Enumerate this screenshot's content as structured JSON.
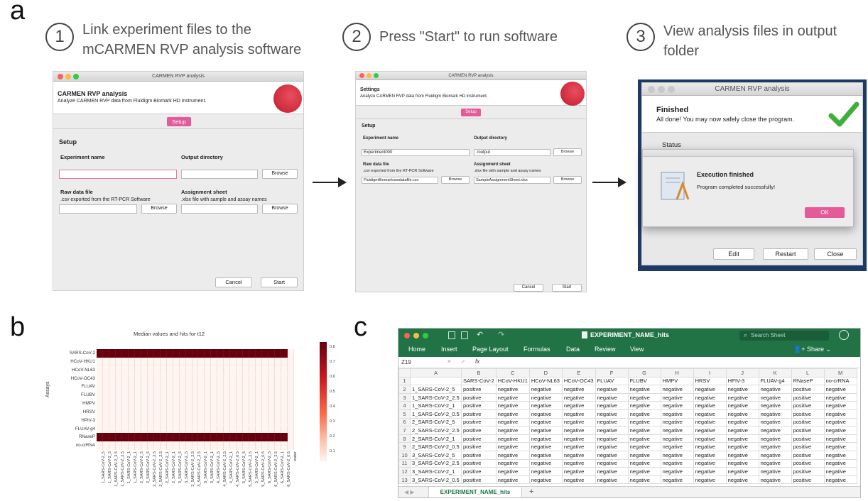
{
  "panels": {
    "a": "a",
    "b": "b",
    "c": "c"
  },
  "steps": [
    {
      "num": "1",
      "text": "Link experiment files to the mCARMEN RVP analysis software"
    },
    {
      "num": "2",
      "text": "Press \"Start\" to run software"
    },
    {
      "num": "3",
      "text": "View analysis files in output folder"
    }
  ],
  "win1": {
    "title": "CARMEN RVP analysis",
    "header_title": "CARMEN RVP analysis",
    "header_sub": "Analyze CARMEN RVP data from Fluidigm Biomark HD instrument.",
    "tab": "Setup",
    "section": "Setup",
    "exp_label": "Experiment name",
    "out_label": "Output directory",
    "browse": "Browse",
    "raw_label": "Raw data file",
    "raw_sub": ".csv exported from the RT-PCR Software",
    "assign_label": "Assignment sheet",
    "assign_sub": ".xlsx file with sample and assay names",
    "cancel": "Cancel",
    "start": "Start"
  },
  "win2": {
    "title": "CARMEN RVP analysis",
    "header_title": "Settings",
    "header_sub": "Analyze CARMEN RVP data from Fluidigm Biomark HD instrument.",
    "tab": "Setup",
    "section": "Setup",
    "exp_label": "Experiment name",
    "exp_value": "Experiment000",
    "out_label": "Output directory",
    "out_value": "./output",
    "browse": "Browse",
    "raw_label": "Raw data file",
    "raw_sub": ".csv exported from the RT-PCR Software",
    "raw_value": "FluidigmBiomarkrawdatafile.csv",
    "assign_label": "Assignment sheet",
    "assign_sub": ".xlsx file with sample and assay names",
    "assign_value": "SampleAssignmentSheet.xlsx",
    "cancel": "Cancel",
    "start": "Start"
  },
  "win3": {
    "title": "CARMEN RVP analysis",
    "finished": "Finished",
    "done_msg": "All done! You may now safely close the program.",
    "status": "Status",
    "dialog_title": "Execution finished",
    "dialog_msg": "Program completed successfully!",
    "ok": "OK",
    "edit": "Edit",
    "restart": "Restart",
    "close": "Close"
  },
  "chart_data": {
    "type": "heatmap",
    "title": "Median values and hits for t12",
    "ylabel": "Assays",
    "assays": [
      "SARS-CoV-2",
      "HCoV-HKU1",
      "HCoV-NL63",
      "HCoV-OC43",
      "FLUAV",
      "FLUBV",
      "HMPV",
      "HRSV",
      "HPIV-3",
      "FLUAV-g4",
      "RNaseP",
      "no-crRNA"
    ],
    "samples": [
      "1_SARS-CoV-2_5",
      "1_SARS-CoV-2_5",
      "1_SARS-CoV-2_2.5",
      "1_SARS-CoV-2_2.5",
      "1_SARS-CoV-2_1",
      "1_SARS-CoV-2_1",
      "2_SARS-CoV-2_5",
      "2_SARS-CoV-2_5",
      "2_SARS-CoV-2_2.5",
      "2_SARS-CoV-2_2.5",
      "2_SARS-CoV-2_1",
      "2_SARS-CoV-2_1",
      "3_SARS-CoV-2_5",
      "3_SARS-CoV-2_5",
      "3_SARS-CoV-2_2.5",
      "3_SARS-CoV-2_2.5",
      "3_SARS-CoV-2_1",
      "3_SARS-CoV-2_1",
      "4_SARS-CoV-2_5",
      "4_SARS-CoV-2_2.5",
      "4_SARS-CoV-2_1",
      "4_SARS-CoV-2_0.5",
      "5_SARS-CoV-2_5",
      "5_SARS-CoV-2_2.5",
      "5_SARS-CoV-2_1",
      "5_SARS-CoV-2_0.5",
      "6_SARS-CoV-2_5",
      "6_SARS-CoV-2_2.5",
      "6_SARS-CoV-2_1",
      "6_SARS-CoV-2_0.5",
      "water"
    ],
    "high_rows": [
      0,
      10
    ],
    "high_value": 0.82,
    "low_value": 0.06,
    "colorbar_ticks": [
      "0.8",
      "0.7",
      "0.6",
      "0.5",
      "0.4",
      "0.3",
      "0.2",
      "0.1"
    ],
    "color_low": "#fff5f0",
    "color_high": "#67000d"
  },
  "excel": {
    "title": "EXPERIMENT_NAME_hits",
    "search": "Search Sheet",
    "menu": [
      "Home",
      "Insert",
      "Page Layout",
      "Formulas",
      "Data",
      "Review",
      "View"
    ],
    "share": "Share",
    "cell_ref": "Z19",
    "fx": "fx",
    "columns": [
      "A",
      "B",
      "C",
      "D",
      "E",
      "F",
      "G",
      "H",
      "I",
      "J",
      "K",
      "L",
      "M"
    ],
    "header_row": [
      "",
      "SARS-CoV-2",
      "HCoV-HKU1",
      "HCoV-NL63",
      "HCoV-OC43",
      "FLUAV",
      "FLUBV",
      "HMPV",
      "HRSV",
      "HPIV-3",
      "FLUAV-g4",
      "RNaseP",
      "no-crRNA"
    ],
    "rows": [
      [
        "1_SARS-CoV-2_5",
        "positive",
        "negative",
        "negative",
        "negative",
        "negative",
        "negative",
        "negative",
        "negative",
        "negative",
        "negative",
        "positive",
        "negative"
      ],
      [
        "1_SARS-CoV-2_2.5",
        "positive",
        "negative",
        "negative",
        "negative",
        "negative",
        "negative",
        "negative",
        "negative",
        "negative",
        "negative",
        "positive",
        "negative"
      ],
      [
        "1_SARS-CoV-2_1",
        "positive",
        "negative",
        "negative",
        "negative",
        "negative",
        "negative",
        "negative",
        "negative",
        "negative",
        "negative",
        "positive",
        "negative"
      ],
      [
        "1_SARS-CoV-2_0.5",
        "positive",
        "negative",
        "negative",
        "negative",
        "negative",
        "negative",
        "negative",
        "negative",
        "negative",
        "negative",
        "positive",
        "negative"
      ],
      [
        "2_SARS-CoV-2_5",
        "positive",
        "negative",
        "negative",
        "negative",
        "negative",
        "negative",
        "negative",
        "negative",
        "negative",
        "negative",
        "positive",
        "negative"
      ],
      [
        "2_SARS-CoV-2_2.5",
        "positive",
        "negative",
        "negative",
        "negative",
        "negative",
        "negative",
        "negative",
        "negative",
        "negative",
        "negative",
        "positive",
        "negative"
      ],
      [
        "2_SARS-CoV-2_1",
        "positive",
        "negative",
        "negative",
        "negative",
        "negative",
        "negative",
        "negative",
        "negative",
        "negative",
        "negative",
        "positive",
        "negative"
      ],
      [
        "2_SARS-CoV-2_0.5",
        "positive",
        "negative",
        "negative",
        "negative",
        "negative",
        "negative",
        "negative",
        "negative",
        "negative",
        "negative",
        "positive",
        "negative"
      ],
      [
        "3_SARS-CoV-2_5",
        "positive",
        "negative",
        "negative",
        "negative",
        "negative",
        "negative",
        "negative",
        "negative",
        "negative",
        "negative",
        "positive",
        "negative"
      ],
      [
        "3_SARS-CoV-2_2.5",
        "positive",
        "negative",
        "negative",
        "negative",
        "negative",
        "negative",
        "negative",
        "negative",
        "negative",
        "negative",
        "positive",
        "negative"
      ],
      [
        "3_SARS-CoV-2_1",
        "positive",
        "negative",
        "negative",
        "negative",
        "negative",
        "negative",
        "negative",
        "negative",
        "negative",
        "negative",
        "positive",
        "negative"
      ],
      [
        "3_SARS-CoV-2_0.5",
        "positive",
        "negative",
        "negative",
        "negative",
        "negative",
        "negative",
        "negative",
        "negative",
        "negative",
        "negative",
        "positive",
        "negative"
      ]
    ],
    "sheet_tab": "EXPERIMENT_NAME_hits",
    "accent": "#1d7a45"
  }
}
